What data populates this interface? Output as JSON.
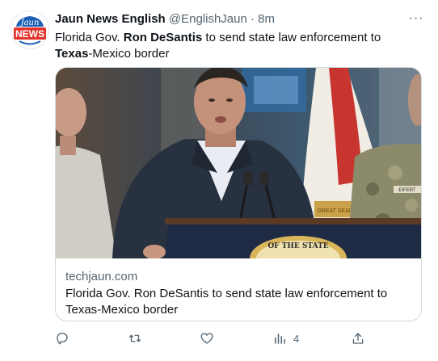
{
  "tweet": {
    "avatar": {
      "logo_top": "Jaun",
      "logo_bottom": "NEWS"
    },
    "author_name": "Jaun News English",
    "handle": "@EnglishJaun",
    "separator": "·",
    "time": "8m",
    "more_label": "···",
    "text": {
      "part1": "Florida Gov. ",
      "bold1": "Ron DeSantis",
      "part2": " to send state law enforcement to ",
      "bold2": "Texas",
      "part3": "-Mexico border"
    }
  },
  "card": {
    "image_alt": "Florida Governor Ron DeSantis speaking at a podium",
    "podium_seal_text": "OF THE STATE",
    "flag_text": "GREAT SEAL",
    "uniform_tag": "EIFERT",
    "domain": "techjaun.com",
    "title": "Florida Gov. Ron DeSantis to send state law enforcement to Texas-Mexico border"
  },
  "actions": {
    "reply": {
      "icon": "reply-icon",
      "count": ""
    },
    "repost": {
      "icon": "repost-icon",
      "count": ""
    },
    "like": {
      "icon": "like-icon",
      "count": ""
    },
    "views": {
      "icon": "views-icon",
      "count": "4"
    },
    "share": {
      "icon": "share-icon",
      "count": ""
    }
  },
  "colors": {
    "secondary_text": "#536471",
    "border": "#cfd9de",
    "logo_red": "#e5322d",
    "logo_blue": "#1d5fb4"
  }
}
